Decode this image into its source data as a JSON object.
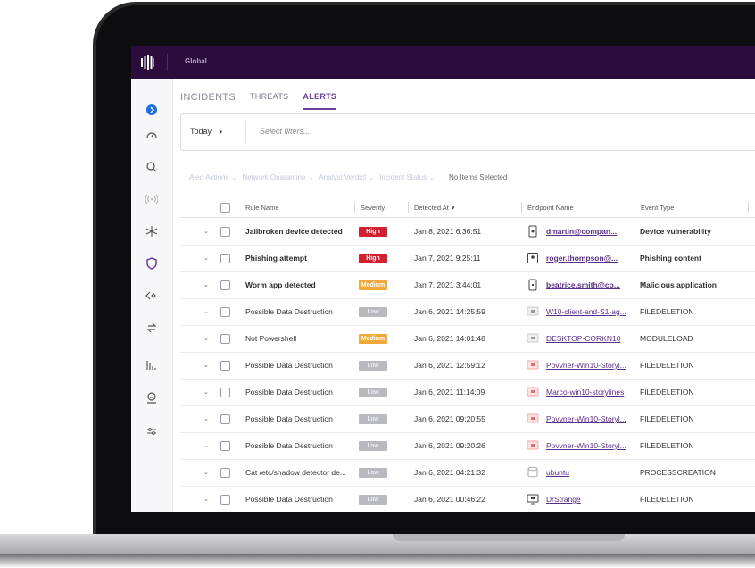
{
  "topbar": {
    "scope_label": "Global"
  },
  "tabs": [
    {
      "label": "INCIDENTS"
    },
    {
      "label": "THREATS"
    },
    {
      "label": "ALERTS"
    }
  ],
  "filterbar": {
    "date_value": "Today",
    "filters_placeholder": "Select filters..."
  },
  "actionbar": {
    "alert_actions": "Alert Actions",
    "network_quarantine": "Network Quarantine",
    "analyst_verdict": "Analyst Verdict",
    "incident_status": "Incident Status",
    "selection_status": "No Items Selected"
  },
  "columns": {
    "rule_name": "Rule Name",
    "severity": "Severity",
    "detected_at": "Detected At",
    "endpoint_name": "Endpoint Name",
    "event_type": "Event Type"
  },
  "rows": [
    {
      "rule": "Jailbroken device detected",
      "severity": "High",
      "detected": "Jan 8, 2021 6:36:51",
      "endpoint": "dmartin@compan...",
      "event": "Device vulnerability",
      "icon": "mobile-icon"
    },
    {
      "rule": "Phishing attempt",
      "severity": "High",
      "detected": "Jan 7, 2021 9:25:11",
      "endpoint": "roger.thompson@...",
      "event": "Phishing content",
      "icon": "tablet-icon"
    },
    {
      "rule": "Worm app detected",
      "severity": "Medium",
      "detected": "Jan 7, 2021 3:44:01",
      "endpoint": "beatrice.smith@co...",
      "event": "Malicious application",
      "icon": "apple-phone-icon"
    },
    {
      "rule": "Possible Data Destruction",
      "severity": "Low",
      "detected": "Jan 6, 2021 14:25:59",
      "endpoint": "W10-client-and-S1-ag...",
      "event": "FILEDELETION",
      "icon": "windows-icon"
    },
    {
      "rule": "Not Powershell",
      "severity": "Medium",
      "detected": "Jan 6, 2021 14:01:48",
      "endpoint": "DESKTOP-CORKN10",
      "event": "MODULELOAD",
      "icon": "windows-icon"
    },
    {
      "rule": "Possible Data Destruction",
      "severity": "Low",
      "detected": "Jan 6, 2021 12:59:12",
      "endpoint": "Povvner-Win10-Storyl...",
      "event": "FILEDELETION",
      "icon": "windows-alert-icon"
    },
    {
      "rule": "Possible Data Destruction",
      "severity": "Low",
      "detected": "Jan 6, 2021 11:14:09",
      "endpoint": "Marco-win10-storylines",
      "event": "FILEDELETION",
      "icon": "windows-alert-icon"
    },
    {
      "rule": "Possible Data Destruction",
      "severity": "Low",
      "detected": "Jan 6, 2021 09:20:55",
      "endpoint": "Povvner-Win10-Storyl...",
      "event": "FILEDELETION",
      "icon": "windows-alert-icon"
    },
    {
      "rule": "Possible Data Destruction",
      "severity": "Low",
      "detected": "Jan 6, 2021 09:20:26",
      "endpoint": "Povvner-Win10-Storyl...",
      "event": "FILEDELETION",
      "icon": "windows-alert-icon"
    },
    {
      "rule": "Cat /etc/shadow detector de...",
      "severity": "Low",
      "detected": "Jan 6, 2021 04:21:32",
      "endpoint": "ubuntu",
      "event": "PROCESSCREATION",
      "icon": "server-icon"
    },
    {
      "rule": "Possible Data Destruction",
      "severity": "Low",
      "detected": "Jan 6, 2021 00:46:22",
      "endpoint": "DrStrange",
      "event": "FILEDELETION",
      "icon": "desktop-icon"
    }
  ],
  "colors": {
    "brand_purple": "#2b0c3c",
    "accent_purple": "#6b3fa0",
    "severity_high": "#d3202e",
    "severity_medium": "#f2a93b",
    "severity_low": "#b9b9c0",
    "active_nav": "#1f6fe0"
  },
  "sidebar_icons": [
    "info-circle-icon",
    "gauge-icon",
    "search-icon",
    "radar-icon",
    "network-icon",
    "shield-icon",
    "code-icon",
    "sync-icon",
    "bar-chart-icon",
    "user-icon",
    "sliders-icon"
  ]
}
